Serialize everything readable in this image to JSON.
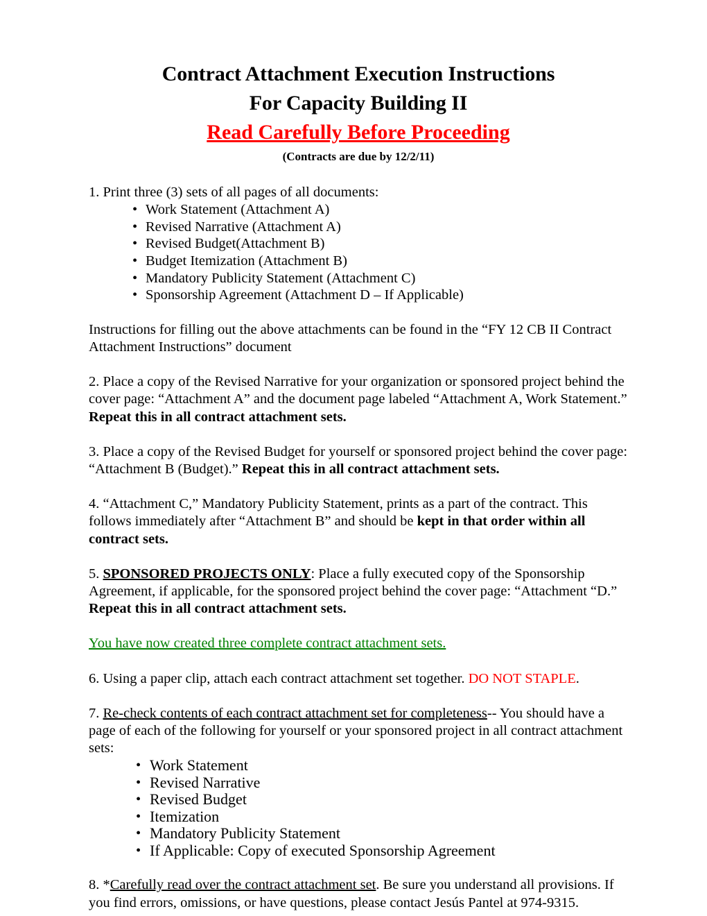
{
  "document": {
    "title_lines": [
      "Contract Attachment Execution Instructions",
      "For Capacity Building II"
    ],
    "title_warning": "Read Carefully Before Proceeding",
    "title_subtitle": "(Contracts are due by 12/2/11)",
    "colors": {
      "warning_red": "#FF0000",
      "note_green": "#008000",
      "body_black": "#000000"
    }
  },
  "item1": {
    "text": "1.   Print three (3) sets of all pages of all documents:",
    "bullets": [
      "Work Statement (Attachment A)",
      "Revised Narrative (Attachment A)",
      "Revised Budget(Attachment B)",
      "Budget Itemization (Attachment B)",
      "Mandatory Publicity Statement (Attachment C)",
      "Sponsorship Agreement (Attachment D – If Applicable)"
    ],
    "bullet_glyph": "•"
  },
  "instructions_note": "Instructions for filling out the above attachments can be found in the “FY 12 CB II Contract Attachment Instructions” document",
  "item2": {
    "lead": "2.  Place a copy of the Revised Narrative for your organization or sponsored project behind the cover page: “Attachment A” and the document page labeled “Attachment A, Work Statement.” ",
    "bold_tail": "Repeat this in all contract attachment sets."
  },
  "item3": {
    "lead": "3.  Place a copy of the Revised Budget for yourself or sponsored project behind the cover page: “Attachment B (Budget).”  ",
    "bold_tail": "Repeat this in all contract attachment sets."
  },
  "item4": {
    "lead": "4.  “Attachment C,” Mandatory Publicity Statement, prints as a part of the contract.  This follows immediately after “Attachment B” and should be ",
    "bold_tail": "kept in that order within all contract sets."
  },
  "item5": {
    "number": "5.   ",
    "emphasis": "SPONSORED PROJECTS ONLY",
    "after_emphasis": ":  Place a fully executed copy of the Sponsorship Agreement, if applicable, for the sponsored project behind the cover page: “Attachment “D.” ",
    "bold_tail": "Repeat this in all contract attachment sets."
  },
  "green_note": "You have now created three complete contract attachment sets.",
  "item6": {
    "lead": "6.  Using a paper clip, attach each contract attachment set together.  ",
    "red_text": "DO NOT STAPLE",
    "tail": "."
  },
  "item7": {
    "number": "7. ",
    "underlined": "Re-check contents of each contract attachment set for completeness",
    "tail": "--  You should have a page of each of the following for yourself or your sponsored project in all contract attachment sets:",
    "bullets": [
      "Work Statement",
      "Revised Narrative",
      "Revised Budget",
      "Itemization",
      "Mandatory Publicity Statement",
      "If Applicable:  Copy of executed Sponsorship Agreement"
    ],
    "bullet_glyph": "•"
  },
  "item8": {
    "number": "8.   *",
    "underlined": "Carefully read over the contract attachment set",
    "tail": ".  Be sure you understand all provisions.  If you find errors, omissions, or have questions, please contact Jesús Pantel at 974-9315."
  }
}
